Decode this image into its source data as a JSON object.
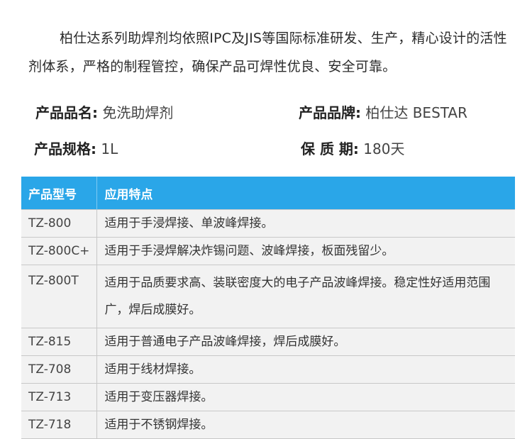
{
  "intro": "柏仕达系列助焊剂均依照IPC及JIS等国际标准研发、生产，精心设计的活性剂体系，严格的制程管控，确保产品可焊性优良、安全可靠。",
  "specs": {
    "name_label": "产品品名:",
    "name_value": "免洗助焊剂",
    "brand_label": "产品品牌:",
    "brand_value": "柏仕达 BESTAR",
    "size_label": "产品规格:",
    "size_value": "1L",
    "shelf_label": "保 质 期:",
    "shelf_value": "180天"
  },
  "table": {
    "headers": [
      "产品型号",
      "应用特点"
    ],
    "rows": [
      {
        "model": "TZ-800",
        "desc": "适用于手浸焊接、单波峰焊接。"
      },
      {
        "model": "TZ-800C+",
        "desc": "适用于手浸焊解决炸锡问题、波峰焊接，板面残留少。"
      },
      {
        "model": "TZ-800T",
        "desc": "适用于品质要求高、装联密度大的电子产品波峰焊接。稳定性好适用范围广，焊后成膜好。"
      },
      {
        "model": "TZ-815",
        "desc": "适用于普通电子产品波峰焊接，焊后成膜好。"
      },
      {
        "model": "TZ-708",
        "desc": "适用于线材焊接。"
      },
      {
        "model": "TZ-713",
        "desc": "适用于变压器焊接。"
      },
      {
        "model": "TZ-718",
        "desc": "适用于不锈钢焊接。"
      }
    ]
  }
}
